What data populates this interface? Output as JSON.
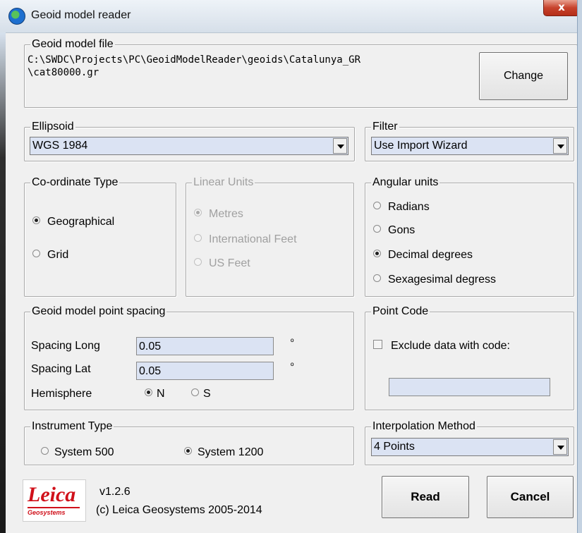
{
  "window": {
    "title": "Geoid model reader",
    "close_label": "x"
  },
  "geoid_file": {
    "legend": "Geoid model file",
    "path_line1": "C:\\SWDC\\Projects\\PC\\GeoidModelReader\\geoids\\Catalunya_GR",
    "path_line2": "\\cat80000.gr",
    "change_label": "Change"
  },
  "ellipsoid": {
    "legend": "Ellipsoid",
    "selected": "WGS 1984"
  },
  "filter": {
    "legend": "Filter",
    "selected": "Use Import Wizard"
  },
  "coordinate_type": {
    "legend": "Co-ordinate Type",
    "options": [
      "Geographical",
      "Grid"
    ],
    "selected": "Geographical"
  },
  "linear_units": {
    "legend": "Linear Units",
    "options": [
      "Metres",
      "International Feet",
      "US Feet"
    ],
    "selected": "Metres",
    "enabled": false
  },
  "angular_units": {
    "legend": "Angular units",
    "options": [
      "Radians",
      "Gons",
      "Decimal degrees",
      "Sexagesimal degress"
    ],
    "selected": "Decimal degrees"
  },
  "spacing": {
    "legend": "Geoid model point spacing",
    "long_label": "Spacing  Long",
    "long_value": "0.05",
    "lat_label": "Spacing  Lat",
    "lat_value": "0.05",
    "unit_symbol": "º",
    "hemisphere_label": "Hemisphere",
    "hemisphere_options": [
      "N",
      "S"
    ],
    "hemisphere_selected": "N"
  },
  "point_code": {
    "legend": "Point Code",
    "exclude_label": "Exclude data with code:",
    "exclude_checked": false,
    "code_value": ""
  },
  "instrument": {
    "legend": "Instrument Type",
    "options": [
      "System 500",
      "System 1200"
    ],
    "selected": "System 1200"
  },
  "interpolation": {
    "legend": "Interpolation Method",
    "selected": "4 Points"
  },
  "footer": {
    "logo_text": "Leica",
    "logo_sub": "Geosystems",
    "version": "v1.2.6",
    "copyright": "(c) Leica Geosystems 2005-2014",
    "read_label": "Read",
    "cancel_label": "Cancel"
  },
  "colors": {
    "field_bg": "#dbe3f3",
    "logo_red": "#d0101a",
    "window_bg": "#f0f0f0"
  }
}
